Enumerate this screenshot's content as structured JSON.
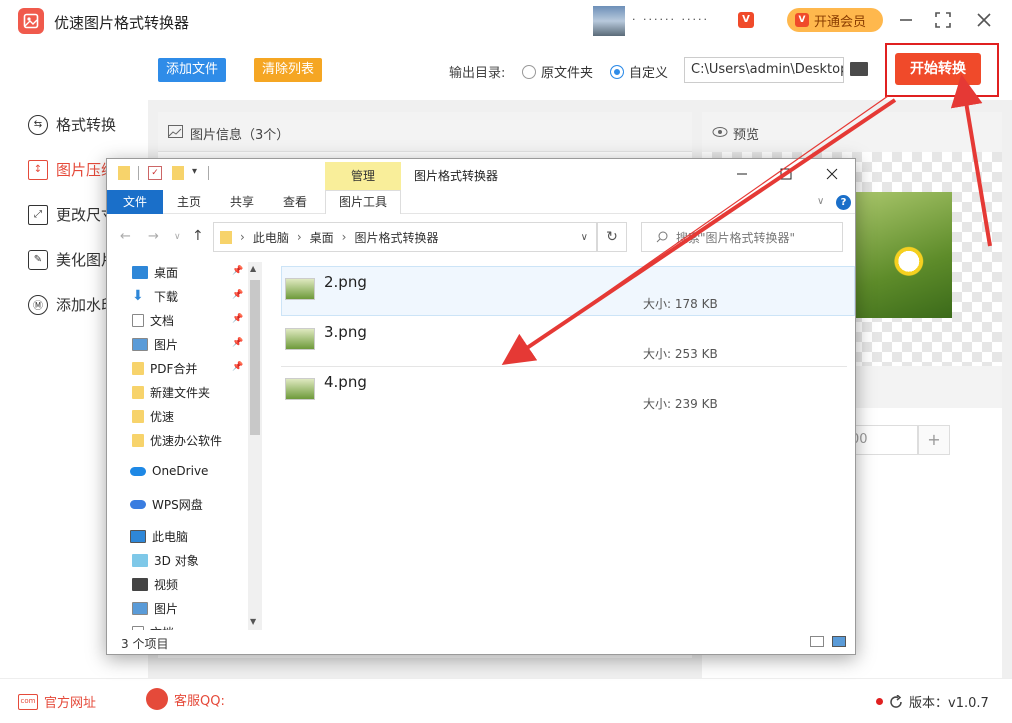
{
  "app": {
    "title": "优速图片格式转换器",
    "user_name": "· ······ ·····",
    "vip_badge": "V",
    "vip_button": "开通会员",
    "accent_color": "#e54a3a"
  },
  "sidebar": {
    "items": [
      {
        "label": "格式转换",
        "icon": "swap-icon"
      },
      {
        "label": "图片压缩",
        "icon": "compress-icon"
      },
      {
        "label": "更改尺寸",
        "icon": "resize-icon"
      },
      {
        "label": "美化图片",
        "icon": "beautify-icon"
      },
      {
        "label": "添加水印",
        "icon": "watermark-icon"
      }
    ],
    "active_index": 1
  },
  "toolbar": {
    "add_file": "添加文件",
    "clear_list": "清除列表",
    "output_label": "输出目录:",
    "option_original": "原文件夹",
    "option_custom": "自定义",
    "path_value": "C:\\Users\\admin\\Desktop",
    "start_button": "开始转换"
  },
  "panels": {
    "info_title": "图片信息（3个）",
    "preview_title": "预览",
    "quality_value": "00",
    "quality_plus": "+"
  },
  "explorer": {
    "quick_icons": "▾",
    "manage_tab": "管理",
    "window_title": "图片格式转换器",
    "tabs": {
      "file": "文件",
      "home": "主页",
      "share": "共享",
      "view": "查看",
      "picture_tools": "图片工具"
    },
    "address": [
      "此电脑",
      "桌面",
      "图片格式转换器"
    ],
    "search_placeholder": "搜索\"图片格式转换器\"",
    "tree": [
      {
        "label": "桌面",
        "pinned": true
      },
      {
        "label": "下载",
        "pinned": true
      },
      {
        "label": "文档",
        "pinned": true
      },
      {
        "label": "图片",
        "pinned": true
      },
      {
        "label": "PDF合并",
        "pinned": true
      },
      {
        "label": "新建文件夹",
        "pinned": false
      },
      {
        "label": "优速",
        "pinned": false
      },
      {
        "label": "优速办公软件",
        "pinned": false
      },
      {
        "label": "OneDrive",
        "pinned": false
      },
      {
        "label": "WPS网盘",
        "pinned": false
      },
      {
        "label": "此电脑",
        "pinned": false
      },
      {
        "label": "3D 对象",
        "pinned": false
      },
      {
        "label": "视频",
        "pinned": false
      },
      {
        "label": "图片",
        "pinned": false
      },
      {
        "label": "文档",
        "pinned": false
      }
    ],
    "files": [
      {
        "name": "2.png",
        "size": "大小: 178 KB",
        "selected": true
      },
      {
        "name": "3.png",
        "size": "大小: 253 KB",
        "selected": false
      },
      {
        "name": "4.png",
        "size": "大小: 239 KB",
        "selected": false
      }
    ],
    "status_count": "3 个项目"
  },
  "footer": {
    "site_link": "官方网址",
    "site_icon_text": "com",
    "qq_label": "客服QQ:",
    "version": "版本：v1.0.7"
  }
}
